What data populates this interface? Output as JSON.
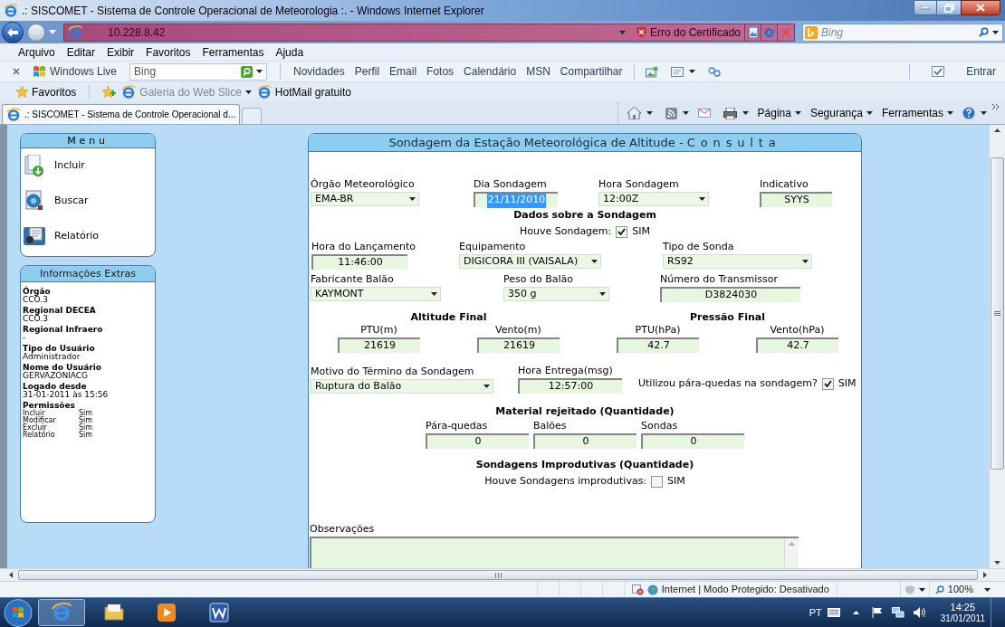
{
  "window": {
    "title": ".: SISCOMET - Sistema de Controle Operacional de Meteorologia :. - Windows Internet Explorer"
  },
  "address_bar": {
    "url": "10.228.8.42",
    "certificate": "Erro do Certificado",
    "search_placeholder": "Bing"
  },
  "menu_bar": [
    "Arquivo",
    "Editar",
    "Exibir",
    "Favoritos",
    "Ferramentas",
    "Ajuda"
  ],
  "live_toolbar": {
    "brand": "Windows Live",
    "search_placeholder": "Bing",
    "links": [
      "Novidades",
      "Perfil",
      "Email",
      "Fotos",
      "Calendário",
      "MSN",
      "Compartilhar"
    ],
    "sign_in": "Entrar"
  },
  "favorites_bar": {
    "label": "Favoritos",
    "links": [
      {
        "label": "Galeria do Web Slice",
        "kind": "menu"
      },
      {
        "label": "HotMail gratuito",
        "kind": "link"
      }
    ]
  },
  "tabs": [
    {
      "label": ".: SISCOMET - Sistema de Controle Operacional d...",
      "selected": true
    }
  ],
  "command_bar": [
    "Página",
    "Segurança",
    "Ferramentas"
  ],
  "sidebar": {
    "menu": {
      "title": "Menu",
      "items": [
        "Incluir",
        "Buscar",
        "Relatório"
      ]
    },
    "info": {
      "title": "Informações Extras",
      "entries": [
        {
          "label": "Órgão",
          "value": "CCO.3"
        },
        {
          "label": "Regional DECEA",
          "value": "CCO.3"
        },
        {
          "label": "Regional Infraero",
          "value": "-"
        },
        {
          "label": "Tipo do Usuário",
          "value": "Administrador"
        },
        {
          "label": "Nome do Usuário",
          "value": "GERVAZONIACG"
        },
        {
          "label": "Logado desde",
          "value": "31-01-2011 às 15:56"
        }
      ],
      "permissions": {
        "title": "Permissões",
        "rows": [
          {
            "action": "Incluir",
            "value": "Sim"
          },
          {
            "action": "Modificar",
            "value": "Sim"
          },
          {
            "action": "Excluir",
            "value": "Sim"
          },
          {
            "action": "Relatório",
            "value": "Sim"
          }
        ]
      }
    }
  },
  "form": {
    "title": "Sondagem da Estação Meteorológica de Altitude -",
    "mode": "Consulta",
    "header_fields": [
      {
        "label": "Órgão Meteorológico",
        "value": "EMA-BR",
        "kind": "select"
      },
      {
        "label": "Dia Sondagem",
        "value": "21/11/2010",
        "kind": "text",
        "highlighted": true
      },
      {
        "label": "Hora Sondagem",
        "value": "12:00Z",
        "kind": "select"
      },
      {
        "label": "Indicativo",
        "value": "SYYS",
        "kind": "text",
        "highlighted": false
      }
    ],
    "data_section": "Dados sobre a Sondagem",
    "houve_sondagem": {
      "label": "Houve Sondagem:",
      "option": "SIM",
      "checked": true
    },
    "launch_fields": [
      {
        "label": "Hora do Lançamento",
        "value": "11:46:00",
        "kind": "text"
      },
      {
        "label": "Equipamento",
        "value": "DIGICORA III (VAISALA)",
        "kind": "select"
      },
      {
        "label": "Tipo de Sonda",
        "value": "RS92",
        "kind": "select"
      }
    ],
    "balloon_fields": [
      {
        "label": "Fabricante Balão",
        "value": "KAYMONT",
        "kind": "select"
      },
      {
        "label": "Peso do Balão",
        "value": "350 g",
        "kind": "select"
      },
      {
        "label": "Número do Transmissor",
        "value": "D3824030",
        "kind": "text"
      }
    ],
    "final_groups": [
      {
        "title": "Altitude Final",
        "fields": [
          {
            "label": "PTU(m)",
            "value": "21619",
            "kind": "text"
          },
          {
            "label": "Vento(m)",
            "value": "21619",
            "kind": "text"
          }
        ]
      },
      {
        "title": "Pressão Final",
        "fields": [
          {
            "label": "PTU(hPa)",
            "value": "42.7",
            "kind": "text"
          },
          {
            "label": "Vento(hPa)",
            "value": "42.7",
            "kind": "text"
          }
        ]
      }
    ],
    "end_fields": [
      {
        "label": "Motivo do Término da Sondagem",
        "value": "Ruptura do Balão",
        "kind": "select"
      },
      {
        "label": "Hora Entrega(msg)",
        "value": "12:57:00",
        "kind": "text"
      }
    ],
    "parachute": {
      "label": "Utilizou pára-quedas na sondagem?",
      "option": "SIM",
      "checked": true
    },
    "rejected": {
      "title": "Material rejeitado (Quantidade)",
      "fields": [
        {
          "label": "Pára-quedas",
          "value": "0",
          "kind": "text"
        },
        {
          "label": "Balões",
          "value": "0",
          "kind": "text"
        },
        {
          "label": "Sondas",
          "value": "0",
          "kind": "text"
        }
      ]
    },
    "unproductive": {
      "title": "Sondagens Improdutivas (Quantidade)",
      "question": {
        "label": "Houve Sondagens improdutivas:",
        "option": "SIM",
        "checked": false
      }
    },
    "notes": {
      "label": "Observações"
    }
  },
  "status_bar": {
    "zone": "Internet | Modo Protegido: Desativado",
    "zoom": "100%"
  },
  "taskbar": {
    "language": "PT",
    "time": "14:25",
    "date": "31/01/2011"
  }
}
